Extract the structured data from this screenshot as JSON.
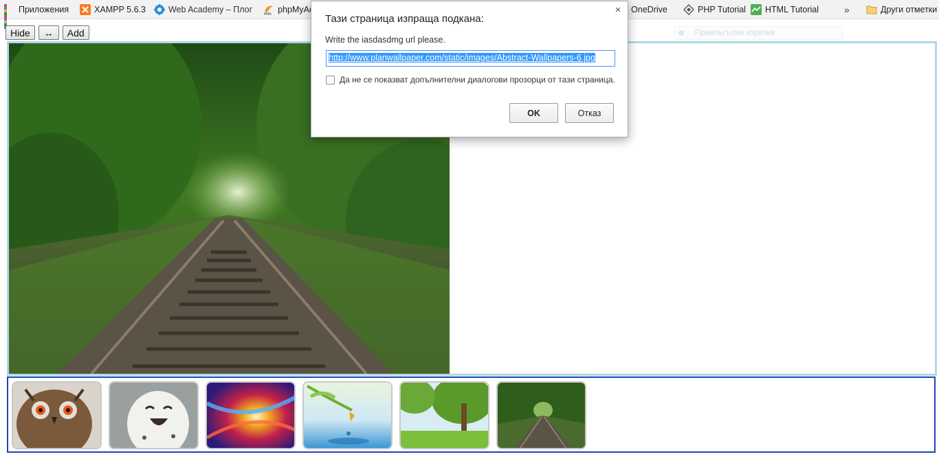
{
  "bookmarks": {
    "apps_label": "Приложения",
    "items": [
      {
        "label": "XAMPP 5.6.3",
        "icon": "xampp-icon"
      },
      {
        "label": "Web Academy – Плог",
        "icon": "web-academy-icon"
      },
      {
        "label": "phpMyAdmin",
        "icon": "phpmyadmin-icon"
      },
      {
        "label": "e - OneDrive",
        "icon": "onedrive-icon"
      },
      {
        "label": "PHP Tutorial",
        "icon": "php-tutorial-icon"
      },
      {
        "label": "HTML Tutorial",
        "icon": "html-tutorial-icon"
      }
    ],
    "more": "»",
    "other_label": "Други отметки"
  },
  "toolbar": {
    "hide_label": "Hide",
    "swap_label": "↔",
    "add_label": "Add"
  },
  "faded_option": "Правоъгълна изрезка",
  "dialog": {
    "title": "Тази страница изпраща подкана:",
    "message": "Write the iasdasdmg url please.",
    "input_value": "http://www.planwallpaper.com/static/images/Abstract-Wallpapers-6.jpg",
    "checkbox_label": "Да не се показват допълнителни диалогови прозорци от тази страница.",
    "ok_label": "OK",
    "cancel_label": "Отказ",
    "close_glyph": "×"
  },
  "main_image": {
    "subject": "railway-forest"
  },
  "thumbnails": [
    {
      "subject": "owl"
    },
    {
      "subject": "snowy-owl"
    },
    {
      "subject": "abstract-swirl"
    },
    {
      "subject": "butterfly-water-drop"
    },
    {
      "subject": "meadow-tree"
    },
    {
      "subject": "railway-forest"
    }
  ],
  "colors": {
    "viewer_border": "#add8e6",
    "thumbs_border": "#1a44b8",
    "selection": "#3399ff"
  }
}
